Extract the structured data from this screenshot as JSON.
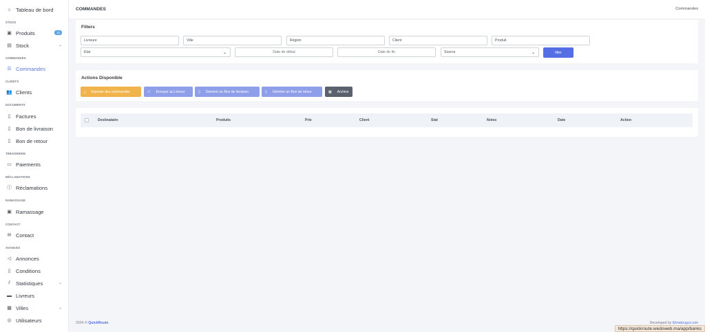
{
  "sidebar": {
    "top_item": "Tableau de bord",
    "sections": {
      "stock": "STOCK",
      "commandes": "COMMANDES",
      "clients": "CLIENTS",
      "documents": "DOCUMENTS",
      "tresorerie": "TRÉSORERIE",
      "reclamations": "RÉCLAMATIONS",
      "ramassage": "RAMASSAGE",
      "contact": "CONTACT",
      "avances": "AVANCÉS"
    },
    "items": {
      "produits": "Produits",
      "produits_badge": "12",
      "stock": "Stock",
      "commandes": "Commandes",
      "clients": "Clients",
      "factures": "Factures",
      "bon_livraison": "Bon de livraison",
      "bon_retour": "Bon de retour",
      "paiements": "Paiements",
      "reclamations": "Réclamations",
      "ramassage": "Ramassage",
      "contact": "Contact",
      "annonces": "Annonces",
      "conditions": "Conditions",
      "statistiques": "Statistiques",
      "livreurs": "Livreurs",
      "villes": "Villes",
      "utilisateurs": "Utilisateurs"
    }
  },
  "header": {
    "title": "COMMANDES",
    "breadcrumb": "Commandes"
  },
  "filters": {
    "title": "Filters",
    "livreur": "Livreure",
    "ville": "Ville",
    "region": "Région",
    "client": "Client",
    "produit": "Produit",
    "etat": "Etat",
    "date_debut": "Date de début",
    "date_fin": "Date de fin",
    "source": "Source",
    "button": "filter"
  },
  "actions": {
    "title": "Actions Disponible",
    "importer": "Importer des commandes",
    "envoyer": "Envoyer au Livreur",
    "generer_livraison": "Générer un Bon de livraison",
    "generer_retour": "Générer un Bon de retour",
    "archive": "Archive"
  },
  "table": {
    "columns": {
      "destinataire": "Destinataire",
      "produits": "Produits",
      "prix": "Prix",
      "client": "Client",
      "stat": "Stat",
      "notes": "Notes",
      "date": "Date",
      "action": "Action"
    }
  },
  "footer": {
    "copyright": "2024 © ",
    "brand": "QuickRoute",
    "developed": "Developed by ",
    "developer": "Elmatougui.com"
  },
  "statusbar": {
    "url": "https://quickroute.wedoweb.ma/app/banks"
  },
  "colors": {
    "primary": "#556ee6",
    "warning": "#f1b44c",
    "info_soft": "#8e9ee9",
    "dark": "#5b626e"
  }
}
